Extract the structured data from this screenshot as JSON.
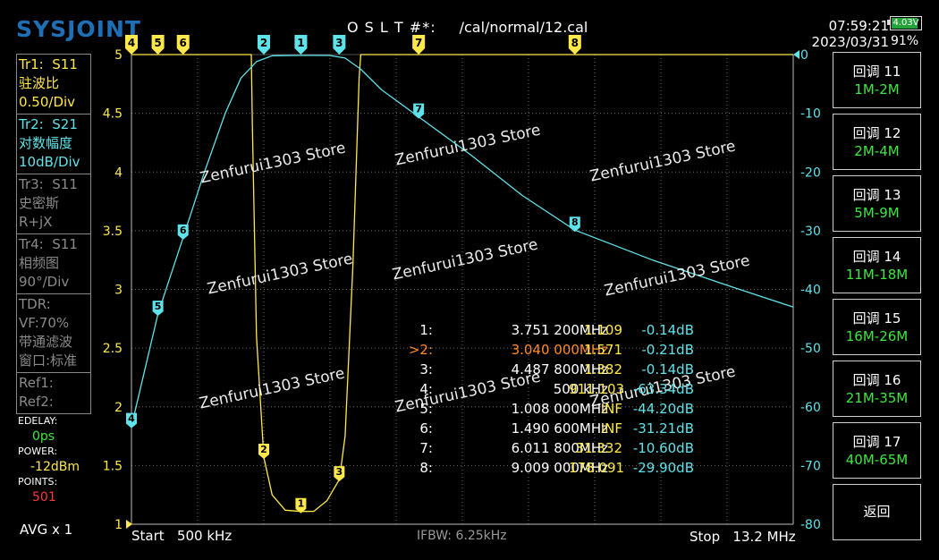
{
  "header": {
    "logo": "SYSJOINT",
    "cal_status": "O S L T #*:",
    "cal_file": "/cal/normal/12.cal",
    "time": "07:59:21",
    "date": "2023/03/31",
    "battery_voltage": "4.03V",
    "battery_percent": "91%",
    "battery_level": 0.91
  },
  "traces": [
    {
      "name": "Tr1:",
      "param": "S11",
      "format": "驻波比",
      "scale": "0.50/Div",
      "color": "#ffe84a"
    },
    {
      "name": "Tr2:",
      "param": "S21",
      "format": "对数幅度",
      "scale": "10dB/Div",
      "color": "#5fe3ea"
    },
    {
      "name": "Tr3:",
      "param": "S11",
      "format": "史密斯",
      "scale": "R+jX",
      "color": "#8a8a8a"
    },
    {
      "name": "Tr4:",
      "param": "S11",
      "format": "相频图",
      "scale": "90°/Div",
      "color": "#8a8a8a"
    }
  ],
  "tdr": {
    "title": "TDR:",
    "vf": "VF:70%",
    "filter": "带通滤波",
    "window": "窗口:标准"
  },
  "refs": {
    "ref1": "Ref1:",
    "ref2": "Ref2:"
  },
  "side": {
    "edelay_label": "EDELAY:",
    "edelay_value": "0ps",
    "power_label": "POWER:",
    "power_value": "-12dBm",
    "points_label": "POINTS:",
    "points_value": "501",
    "avg": "AVG x 1"
  },
  "sweep": {
    "start_label": "Start",
    "start": "500 kHz",
    "ifbw": "IFBW: 6.25kHz",
    "stop_label": "Stop",
    "stop": "13.2 MHz"
  },
  "axes": {
    "left_ticks": [
      "5",
      "4.5",
      "4",
      "3.5",
      "3",
      "2.5",
      "2",
      "1.5",
      "1"
    ],
    "right_ticks": [
      "0",
      "-10",
      "-20",
      "-30",
      "-40",
      "-50",
      "-60",
      "-70",
      "-80"
    ]
  },
  "markers": [
    {
      "num": "1:",
      "freq": "3.751 200MHz",
      "v1": "1.109",
      "v2": "-0.14dB",
      "active": false
    },
    {
      "num": ">2:",
      "freq": "3.040 000MHz",
      "v1": "1.571",
      "v2": "-0.21dB",
      "active": true
    },
    {
      "num": "3:",
      "freq": "4.487 800MHz",
      "v1": "1.382",
      "v2": "-0.14dB",
      "active": false
    },
    {
      "num": "4:",
      "freq": "500 kHz",
      "v1": "911.103",
      "v2": "-63.34dB",
      "active": false
    },
    {
      "num": "5:",
      "freq": "1.008 000MHz",
      "v1": "INF",
      "v2": "-44.20dB",
      "active": false
    },
    {
      "num": "6:",
      "freq": "1.490 600MHz",
      "v1": "INF",
      "v2": "-31.21dB",
      "active": false
    },
    {
      "num": "7:",
      "freq": "6.011 800MHz",
      "v1": "31.332",
      "v2": "-10.60dB",
      "active": false
    },
    {
      "num": "8:",
      "freq": "9.009 000MHz",
      "v1": "178.091",
      "v2": "-29.90dB",
      "active": false
    }
  ],
  "marker_flags": [
    "4",
    "5",
    "6",
    "2",
    "1",
    "3",
    "7",
    "8"
  ],
  "watermark": "Zenfurui1303 Store",
  "buttons": [
    {
      "label": "回调 11",
      "sub": "1M-2M"
    },
    {
      "label": "回调 12",
      "sub": "2M-4M"
    },
    {
      "label": "回调 13",
      "sub": "5M-9M"
    },
    {
      "label": "回调 14",
      "sub": "11M-18M"
    },
    {
      "label": "回调 15",
      "sub": "16M-26M"
    },
    {
      "label": "回调 16",
      "sub": "21M-35M"
    },
    {
      "label": "回调 17",
      "sub": "40M-65M"
    },
    {
      "label": "返回",
      "sub": ""
    }
  ],
  "chart_data": {
    "type": "line",
    "x_unit": "MHz",
    "xlim": [
      0.5,
      13.2
    ],
    "series": [
      {
        "name": "Tr1: S11",
        "color": "#ffe84a",
        "axis": "left",
        "ylim": [
          1,
          5
        ],
        "x": [
          0.5,
          2.8,
          2.82,
          2.9,
          3.04,
          3.2,
          3.45,
          3.75,
          4.0,
          4.25,
          4.49,
          4.6,
          4.75,
          4.87,
          4.9,
          13.2
        ],
        "y": [
          5,
          5,
          4.4,
          2.6,
          1.571,
          1.25,
          1.12,
          1.109,
          1.11,
          1.2,
          1.382,
          1.75,
          3.2,
          4.8,
          5,
          5
        ]
      },
      {
        "name": "Tr2: S21",
        "color": "#5fe3ea",
        "axis": "right",
        "ylim": [
          -80,
          0
        ],
        "x": [
          0.5,
          1.008,
          1.4906,
          1.9,
          2.3,
          2.6,
          2.9,
          3.2,
          3.75,
          4.3,
          4.6,
          4.9,
          5.3,
          6.0118,
          7.0,
          8.0,
          9.009,
          10.5,
          12.0,
          13.2
        ],
        "y": [
          -63.34,
          -44.2,
          -31.21,
          -20,
          -10,
          -4,
          -1.2,
          -0.2,
          -0.14,
          -0.15,
          -0.6,
          -2.5,
          -6,
          -10.6,
          -17,
          -24,
          -29.9,
          -35,
          -39.5,
          -43
        ]
      }
    ],
    "markers": [
      {
        "id": "1",
        "x": 3.7512,
        "s11": 1.109,
        "s21": -0.14
      },
      {
        "id": "2",
        "x": 3.04,
        "s11": 1.571,
        "s21": -0.21
      },
      {
        "id": "3",
        "x": 4.4878,
        "s11": 1.382,
        "s21": -0.14
      },
      {
        "id": "4",
        "x": 0.5,
        "s11": 911.103,
        "s21": -63.34
      },
      {
        "id": "5",
        "x": 1.008,
        "s11": "INF",
        "s21": -44.2
      },
      {
        "id": "6",
        "x": 1.4906,
        "s11": "INF",
        "s21": -31.21
      },
      {
        "id": "7",
        "x": 6.0118,
        "s11": 31.332,
        "s21": -10.6
      },
      {
        "id": "8",
        "x": 9.009,
        "s11": 178.091,
        "s21": -29.9
      }
    ]
  }
}
